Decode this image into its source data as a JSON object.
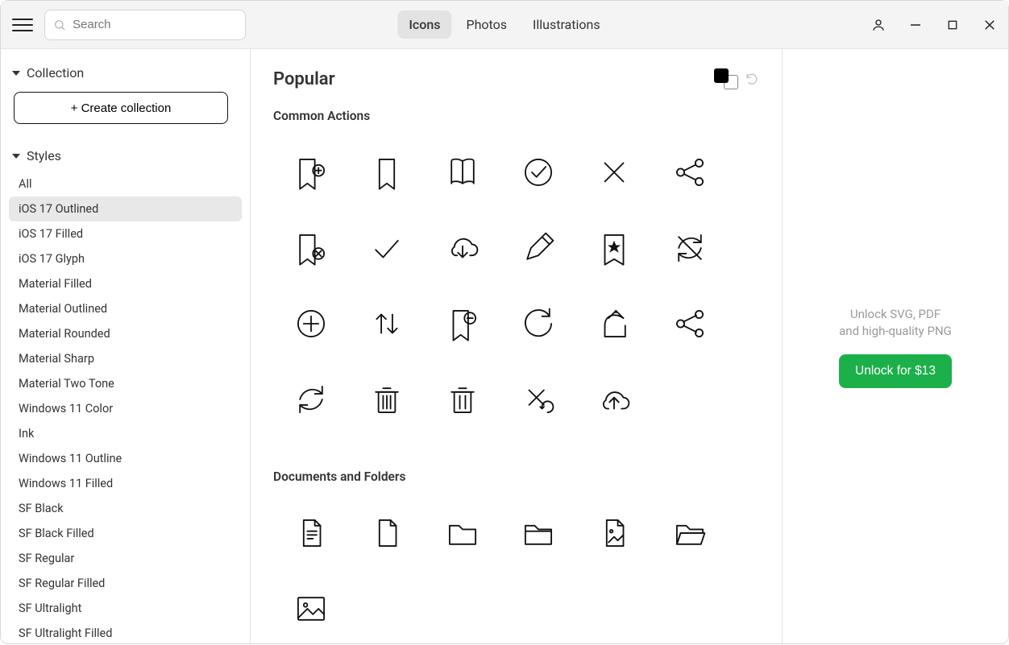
{
  "header": {
    "search_placeholder": "Search",
    "tabs": [
      {
        "label": "Icons",
        "active": true
      },
      {
        "label": "Photos",
        "active": false
      },
      {
        "label": "Illustrations",
        "active": false
      }
    ]
  },
  "sidebar": {
    "collection_label": "Collection",
    "create_collection_label": "+ Create collection",
    "styles_label": "Styles",
    "styles": [
      {
        "label": "All",
        "active": false
      },
      {
        "label": "iOS 17 Outlined",
        "active": true
      },
      {
        "label": "iOS 17 Filled",
        "active": false
      },
      {
        "label": "iOS 17 Glyph",
        "active": false
      },
      {
        "label": "Material Filled",
        "active": false
      },
      {
        "label": "Material Outlined",
        "active": false
      },
      {
        "label": "Material Rounded",
        "active": false
      },
      {
        "label": "Material Sharp",
        "active": false
      },
      {
        "label": "Material Two Tone",
        "active": false
      },
      {
        "label": "Windows 11 Color",
        "active": false
      },
      {
        "label": "Ink",
        "active": false
      },
      {
        "label": "Windows 11 Outline",
        "active": false
      },
      {
        "label": "Windows 11 Filled",
        "active": false
      },
      {
        "label": "SF Black",
        "active": false
      },
      {
        "label": "SF Black Filled",
        "active": false
      },
      {
        "label": "SF Regular",
        "active": false
      },
      {
        "label": "SF Regular Filled",
        "active": false
      },
      {
        "label": "SF Ultralight",
        "active": false
      },
      {
        "label": "SF Ultralight Filled",
        "active": false
      }
    ]
  },
  "main": {
    "title": "Popular",
    "sections": [
      {
        "title": "Common Actions",
        "icons": [
          "bookmark-add",
          "bookmark",
          "book",
          "checkmark-circle",
          "close",
          "share-nodes",
          "bookmark-remove",
          "checkmark",
          "cloud-download",
          "edit-pencil",
          "bookmark-star",
          "sync-off",
          "add-circle",
          "swap-vertical",
          "bookmark-minus",
          "refresh",
          "share-arrow",
          "share-nodes-alt",
          "sync",
          "trash",
          "trash-alt",
          "undo-close",
          "cloud-upload"
        ]
      },
      {
        "title": "Documents and Folders",
        "icons": [
          "document-text",
          "document",
          "folder",
          "folder-alt",
          "image-file",
          "folder-open",
          "image"
        ]
      }
    ]
  },
  "right": {
    "promo_line1": "Unlock SVG, PDF",
    "promo_line2": "and high-quality PNG",
    "unlock_label": "Unlock for $13"
  },
  "colors": {
    "accent": "#1cb04a"
  }
}
